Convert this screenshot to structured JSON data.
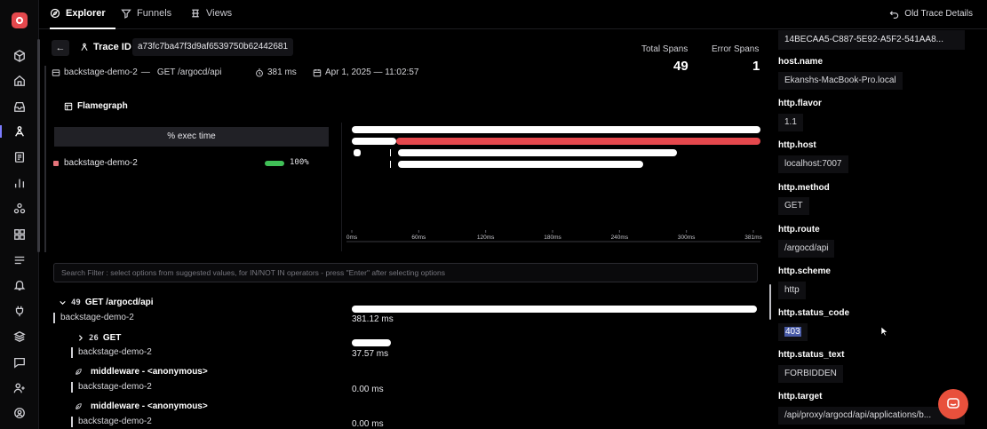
{
  "topbar": {
    "tabs": [
      {
        "label": "Explorer",
        "icon": "compass-icon",
        "active": true
      },
      {
        "label": "Funnels",
        "icon": "funnel-icon",
        "active": false
      },
      {
        "label": "Views",
        "icon": "views-icon",
        "active": false
      }
    ],
    "old_trace_label": "Old Trace Details"
  },
  "trace": {
    "label": "Trace ID",
    "id": "a73fc7ba47f3d9af6539750b62442681",
    "service": "backstage-demo-2",
    "separator": "—",
    "operation": "GET /argocd/api",
    "duration": "381 ms",
    "datetime": "Apr 1, 2025 — 11:02:57",
    "total_spans_label": "Total Spans",
    "total_spans": "49",
    "error_spans_label": "Error Spans",
    "error_spans": "1"
  },
  "flamegraph": {
    "title": "Flamegraph",
    "exec_header": "% exec time",
    "service_name": "backstage-demo-2",
    "service_pct": "100%",
    "service_pct_value": 100,
    "ticks": [
      "0ms",
      "60ms",
      "120ms",
      "180ms",
      "240ms",
      "300ms",
      "381ms"
    ],
    "error_color": "#e5484d",
    "ok_color": "#ffffff"
  },
  "search": {
    "placeholder": "Search Filter : select options from suggested values, for IN/NOT IN operators - press \"Enter\" after selecting options"
  },
  "spans": [
    {
      "count": "49",
      "name": "GET /argocd/api",
      "service": "backstage-demo-2",
      "duration": "381.12 ms"
    },
    {
      "count": "26",
      "name": "GET",
      "service": "backstage-demo-2",
      "duration": "37.57 ms"
    },
    {
      "count": "",
      "name": "middleware - <anonymous>",
      "service": "backstage-demo-2",
      "duration": "0.00 ms"
    },
    {
      "count": "",
      "name": "middleware - <anonymous>",
      "service": "backstage-demo-2",
      "duration": "0.00 ms"
    }
  ],
  "attributes": {
    "top_value": "14BECAA5-C887-5E92-A5F2-541AA8...",
    "items": [
      {
        "key": "host.name",
        "value": "Ekanshs-MacBook-Pro.local"
      },
      {
        "key": "http.flavor",
        "value": "1.1"
      },
      {
        "key": "http.host",
        "value": "localhost:7007"
      },
      {
        "key": "http.method",
        "value": "GET"
      },
      {
        "key": "http.route",
        "value": "/argocd/api"
      },
      {
        "key": "http.scheme",
        "value": "http"
      },
      {
        "key": "http.status_code",
        "value": "403"
      },
      {
        "key": "http.status_text",
        "value": "FORBIDDEN"
      },
      {
        "key": "http.target",
        "value": "/api/proxy/argocd/api/applications/b..."
      }
    ]
  }
}
